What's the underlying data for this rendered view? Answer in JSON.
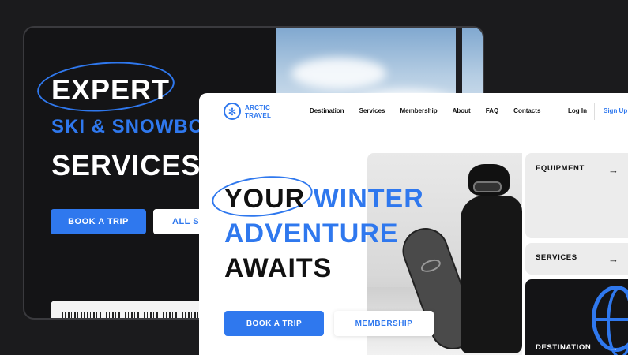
{
  "back_mockup": {
    "headline_1": "EXPERT",
    "headline_2": "SKI & SNOWBO",
    "headline_3": "SERVICES",
    "book_trip_label": "BOOK A TRIP",
    "all_services_label": "ALL SE"
  },
  "front_mockup": {
    "logo": {
      "line1": "ARCTIC",
      "line2": "TRAVEL",
      "icon": "snowflake-icon"
    },
    "nav": {
      "links": [
        "Destination",
        "Services",
        "Membership",
        "About",
        "FAQ",
        "Contacts"
      ],
      "login": "Log In",
      "signup": "Sign Up"
    },
    "hero": {
      "word_your": "YOUR",
      "word_winter": " WINTER",
      "line2": "ADVENTURE",
      "line3": "AWAITS"
    },
    "buttons": {
      "book_trip": "BOOK A TRIP",
      "membership": "MEMBERSHIP"
    },
    "cards": [
      {
        "label": "EQUIPMENT",
        "icon": "arrow-right-icon"
      },
      {
        "label": "SERVICES",
        "icon": "arrow-right-icon"
      },
      {
        "label": "DESTINATION",
        "icon": "arrow-right-icon"
      }
    ]
  },
  "colors": {
    "accent": "#2f78ee",
    "dark_bg": "#1b1b1d",
    "light_bg": "#ffffff",
    "card_bg": "#ececec"
  }
}
